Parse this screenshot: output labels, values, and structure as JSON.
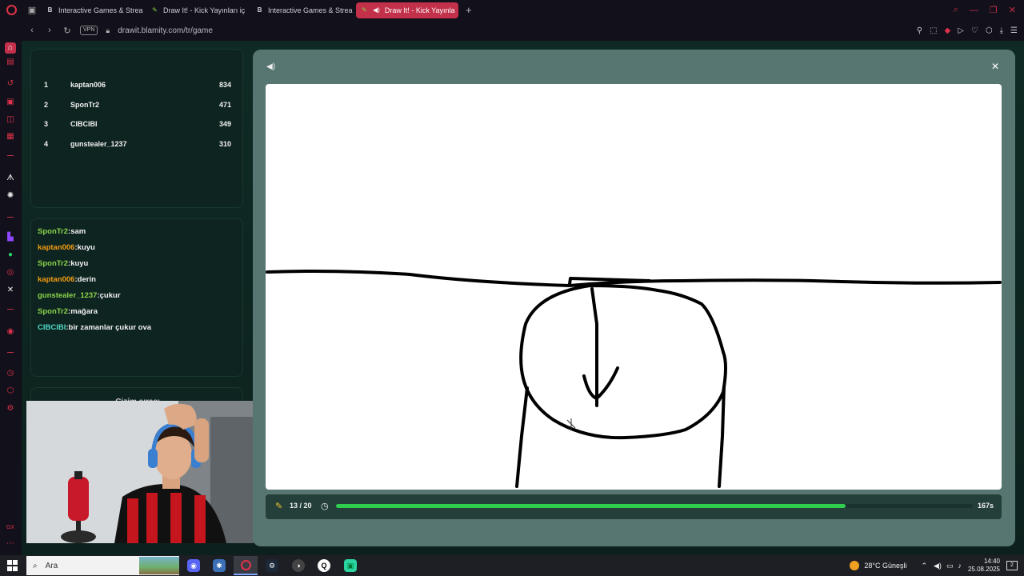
{
  "browser": {
    "tabs": [
      {
        "label": "Interactive Games & Strea",
        "favicon": "B",
        "active": false
      },
      {
        "label": "Draw It! - Kick Yayınları iç",
        "favicon": "✎",
        "active": false
      },
      {
        "label": "Interactive Games & Strea",
        "favicon": "B",
        "active": false
      },
      {
        "label": "Draw It! - Kick Yayınla",
        "favicon": "✎",
        "active": true
      }
    ],
    "new_tab": "+",
    "vpn": "VPN",
    "url": "drawit.blamity.com/tr/game"
  },
  "leaderboard": [
    {
      "rank": "1",
      "name": "kaptan006",
      "score": "834"
    },
    {
      "rank": "2",
      "name": "SponTr2",
      "score": "471"
    },
    {
      "rank": "3",
      "name": "CIBCIBI",
      "score": "349"
    },
    {
      "rank": "4",
      "name": "gunstealer_1237",
      "score": "310"
    }
  ],
  "chat": [
    {
      "user": "SponTr2",
      "message": "sam",
      "color": "green"
    },
    {
      "user": "kaptan006",
      "message": "kuyu",
      "color": "orange"
    },
    {
      "user": "SponTr2",
      "message": "kuyu",
      "color": "green"
    },
    {
      "user": "kaptan006",
      "message": "derin",
      "color": "orange"
    },
    {
      "user": "gunstealer_1237",
      "message": "çukur",
      "color": "green"
    },
    {
      "user": "SponTr2",
      "message": "mağara",
      "color": "green"
    },
    {
      "user": "CIBCIBI",
      "message": "bir zamanlar çukur ova",
      "color": "cyan"
    }
  ],
  "lower_panel_title": "Çizim sırası",
  "game": {
    "round": "13 / 20",
    "time_left": "167s",
    "progress": 0.8,
    "progress_color": "#2fce4e"
  },
  "taskbar": {
    "search_placeholder": "Ara",
    "weather": "28°C Güneşli",
    "time": "14:40",
    "date": "25.08.2025",
    "notifications": "2"
  }
}
